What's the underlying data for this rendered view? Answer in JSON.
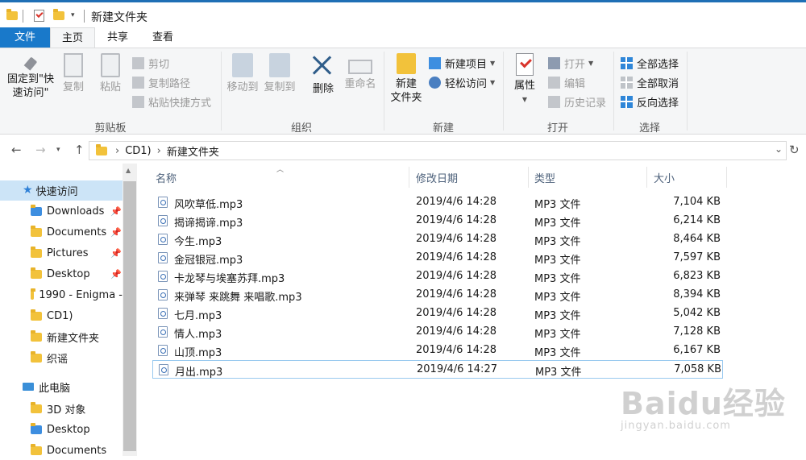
{
  "window": {
    "title": "新建文件夹"
  },
  "ribbon_tabs": [
    {
      "label": "文件"
    },
    {
      "label": "主页"
    },
    {
      "label": "共享"
    },
    {
      "label": "查看"
    }
  ],
  "ribbon": {
    "clipboard": {
      "label": "剪贴板",
      "pin": "固定到\"快速访问\"",
      "pin_line1": "固定到\"快",
      "pin_line2": "速访问\"",
      "copy": "复制",
      "paste": "粘贴",
      "cut": "剪切",
      "copy_path": "复制路径",
      "paste_shortcut": "粘贴快捷方式"
    },
    "organize": {
      "label": "组织",
      "move_to": "移动到",
      "copy_to": "复制到",
      "delete": "删除",
      "rename": "重命名"
    },
    "new": {
      "label": "新建",
      "new_folder_line1": "新建",
      "new_folder_line2": "文件夹",
      "new_item": "新建项目",
      "easy_access": "轻松访问"
    },
    "open": {
      "label": "打开",
      "properties": "属性",
      "open": "打开",
      "edit": "编辑",
      "history": "历史记录"
    },
    "select": {
      "label": "选择",
      "select_all": "全部选择",
      "select_none": "全部取消",
      "invert": "反向选择"
    }
  },
  "address_bar": {
    "crumbs": [
      "CD1)",
      "新建文件夹"
    ]
  },
  "sidebar": {
    "quick_access": "快速访问",
    "items": [
      {
        "label": "Downloads",
        "pinned": true
      },
      {
        "label": "Documents",
        "pinned": true
      },
      {
        "label": "Pictures",
        "pinned": true
      },
      {
        "label": "Desktop",
        "pinned": true
      },
      {
        "label": "1990 - Enigma -",
        "pinned": false
      },
      {
        "label": "CD1)",
        "pinned": false
      },
      {
        "label": "新建文件夹",
        "pinned": false
      },
      {
        "label": "织谣",
        "pinned": false
      }
    ],
    "this_pc": "此电脑",
    "pc_items": [
      {
        "label": "3D 对象"
      },
      {
        "label": "Desktop"
      },
      {
        "label": "Documents"
      }
    ]
  },
  "file_list": {
    "columns": [
      "名称",
      "修改日期",
      "类型",
      "大小"
    ],
    "rows": [
      {
        "name": "风吹草低.mp3",
        "date": "2019/4/6 14:28",
        "type": "MP3 文件",
        "size": "7,104 KB"
      },
      {
        "name": "揭谛揭谛.mp3",
        "date": "2019/4/6 14:28",
        "type": "MP3 文件",
        "size": "6,214 KB"
      },
      {
        "name": "今生.mp3",
        "date": "2019/4/6 14:28",
        "type": "MP3 文件",
        "size": "8,464 KB"
      },
      {
        "name": "金冠银冠.mp3",
        "date": "2019/4/6 14:28",
        "type": "MP3 文件",
        "size": "7,597 KB"
      },
      {
        "name": "卡龙琴与埃塞苏拜.mp3",
        "date": "2019/4/6 14:28",
        "type": "MP3 文件",
        "size": "6,823 KB"
      },
      {
        "name": "来弹琴 来跳舞 来唱歌.mp3",
        "date": "2019/4/6 14:28",
        "type": "MP3 文件",
        "size": "8,394 KB"
      },
      {
        "name": "七月.mp3",
        "date": "2019/4/6 14:28",
        "type": "MP3 文件",
        "size": "5,042 KB"
      },
      {
        "name": "情人.mp3",
        "date": "2019/4/6 14:28",
        "type": "MP3 文件",
        "size": "7,128 KB"
      },
      {
        "name": "山顶.mp3",
        "date": "2019/4/6 14:28",
        "type": "MP3 文件",
        "size": "6,167 KB"
      },
      {
        "name": "月出.mp3",
        "date": "2019/4/6 14:27",
        "type": "MP3 文件",
        "size": "7,058 KB"
      }
    ]
  },
  "watermark": {
    "logo": "Baidu经验",
    "url": "jingyan.baidu.com"
  },
  "colors": {
    "accent": "#1979ca",
    "selection": "#cce4f7"
  }
}
